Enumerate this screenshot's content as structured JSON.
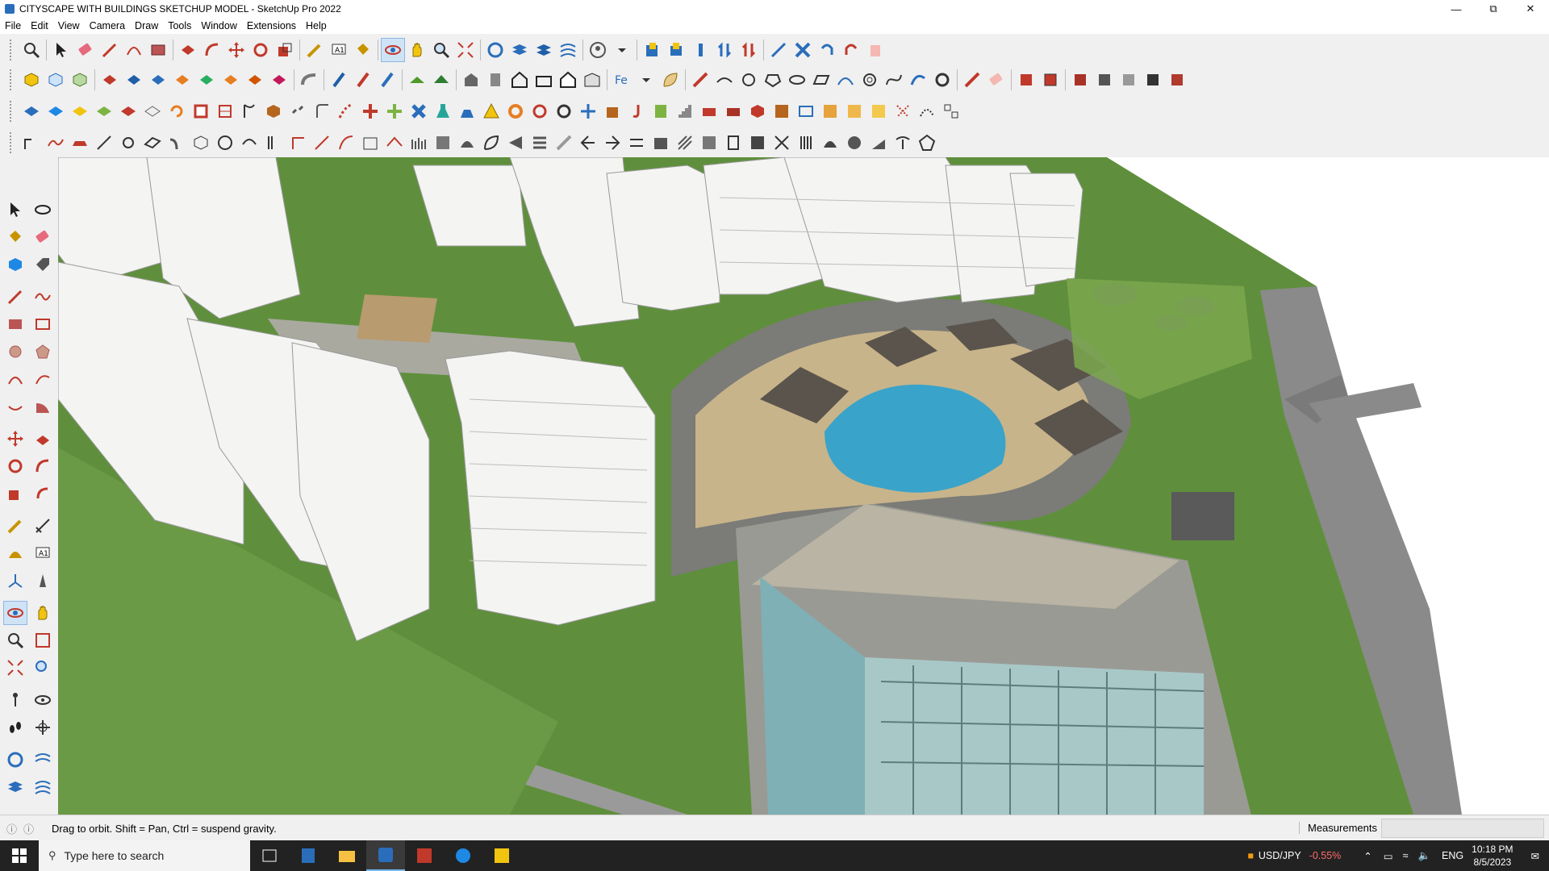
{
  "window": {
    "title": "CITYSCAPE WITH BUILDINGS SKETCHUP MODEL - SketchUp Pro 2022",
    "controls": [
      "minimize",
      "restore",
      "close"
    ]
  },
  "menu": [
    "File",
    "Edit",
    "View",
    "Camera",
    "Draw",
    "Tools",
    "Window",
    "Extensions",
    "Help"
  ],
  "status": {
    "hint": "Drag to orbit. Shift = Pan, Ctrl = suspend gravity.",
    "measurements_label": "Measurements",
    "measurements_value": ""
  },
  "taskbar": {
    "search_placeholder": "Type here to search",
    "ticker_symbol": "USD/JPY",
    "ticker_change": "-0.55%",
    "language": "ENG",
    "time": "10:18 PM",
    "date": "8/5/2023"
  },
  "colors": {
    "accent": "#2a6ebb",
    "grass": "#5f8f3c",
    "water": "#3aa3c9",
    "road": "#8a8a8a"
  }
}
